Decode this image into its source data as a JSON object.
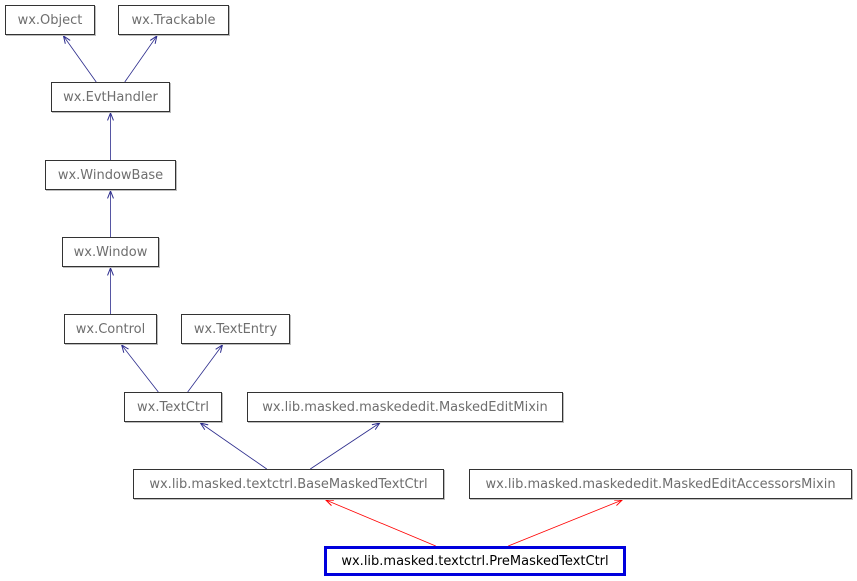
{
  "diagram": {
    "type": "inheritance-graph",
    "colors": {
      "inherit_edge": "#2b2b8c",
      "current_edge": "#ff0000",
      "current_border": "#0000dd"
    },
    "nodes": [
      {
        "id": "object",
        "label": "wx.Object"
      },
      {
        "id": "trackable",
        "label": "wx.Trackable"
      },
      {
        "id": "evthandler",
        "label": "wx.EvtHandler"
      },
      {
        "id": "windowbase",
        "label": "wx.WindowBase"
      },
      {
        "id": "window",
        "label": "wx.Window"
      },
      {
        "id": "control",
        "label": "wx.Control"
      },
      {
        "id": "textentry",
        "label": "wx.TextEntry"
      },
      {
        "id": "textctrl",
        "label": "wx.TextCtrl"
      },
      {
        "id": "maskededitmixin",
        "label": "wx.lib.masked.maskededit.MaskedEditMixin"
      },
      {
        "id": "basemaskedtextctrl",
        "label": "wx.lib.masked.textctrl.BaseMaskedTextCtrl"
      },
      {
        "id": "accessorsmixin",
        "label": "wx.lib.masked.maskededit.MaskedEditAccessorsMixin"
      },
      {
        "id": "premaskedtextctrl",
        "label": "wx.lib.masked.textctrl.PreMaskedTextCtrl",
        "current": true
      }
    ],
    "edges": [
      {
        "from": "evthandler",
        "to": "object",
        "kind": "inherit"
      },
      {
        "from": "evthandler",
        "to": "trackable",
        "kind": "inherit"
      },
      {
        "from": "windowbase",
        "to": "evthandler",
        "kind": "inherit"
      },
      {
        "from": "window",
        "to": "windowbase",
        "kind": "inherit"
      },
      {
        "from": "control",
        "to": "window",
        "kind": "inherit"
      },
      {
        "from": "textctrl",
        "to": "control",
        "kind": "inherit"
      },
      {
        "from": "textctrl",
        "to": "textentry",
        "kind": "inherit"
      },
      {
        "from": "basemaskedtextctrl",
        "to": "textctrl",
        "kind": "inherit"
      },
      {
        "from": "basemaskedtextctrl",
        "to": "maskededitmixin",
        "kind": "inherit"
      },
      {
        "from": "premaskedtextctrl",
        "to": "basemaskedtextctrl",
        "kind": "current"
      },
      {
        "from": "premaskedtextctrl",
        "to": "accessorsmixin",
        "kind": "current"
      }
    ]
  }
}
